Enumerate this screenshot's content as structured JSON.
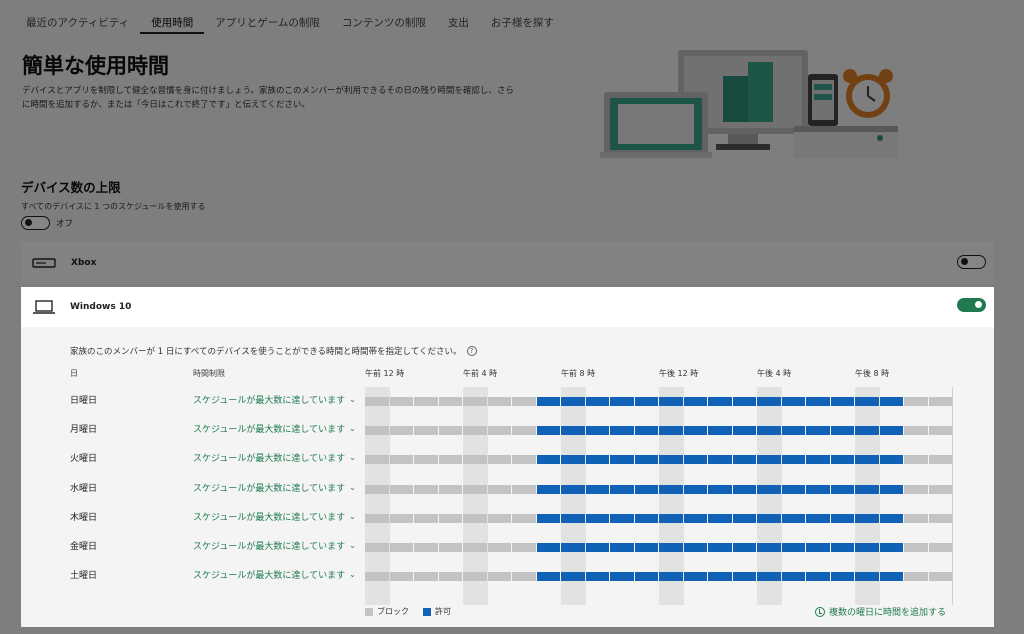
{
  "tabs": [
    {
      "label": "最近のアクティビティ",
      "active": false
    },
    {
      "label": "使用時間",
      "active": true
    },
    {
      "label": "アプリとゲームの制限",
      "active": false
    },
    {
      "label": "コンテンツの制限",
      "active": false
    },
    {
      "label": "支出",
      "active": false
    },
    {
      "label": "お子様を探す",
      "active": false
    }
  ],
  "page": {
    "title": "簡単な使用時間",
    "description": "デバイスとアプリを制限して健全な習慣を身に付けましょう。家族のこのメンバーが利用できるその日の残り時間を確認し、さらに時間を追加するか、または「今日はこれで終了です」と伝えてください。"
  },
  "device_limit": {
    "title": "デバイス数の上限",
    "subtitle": "すべてのデバイスに 1 つのスケジュールを使用する",
    "toggle_state": "オフ",
    "toggle_on": false
  },
  "devices": {
    "xbox": {
      "name": "Xbox",
      "icon": "xbox-console-icon",
      "toggle_on": false
    },
    "windows": {
      "name": "Windows 10",
      "icon": "laptop-icon",
      "toggle_on": true
    }
  },
  "schedule": {
    "description": "家族のこのメンバーが 1 日にすべてのデバイスを使うことができる時間と時間帯を指定してください。",
    "col_day": "日",
    "col_limit": "時間制限",
    "hour_labels": [
      "午前 12 時",
      "午前 4 時",
      "午前 8 時",
      "午後 12 時",
      "午後 4 時",
      "午後 8 時"
    ],
    "allowed_start_hour": 7,
    "allowed_end_hour": 22,
    "days": [
      {
        "day": "日曜日",
        "limit": "スケジュールが最大数に達しています"
      },
      {
        "day": "月曜日",
        "limit": "スケジュールが最大数に達しています"
      },
      {
        "day": "火曜日",
        "limit": "スケジュールが最大数に達しています"
      },
      {
        "day": "水曜日",
        "limit": "スケジュールが最大数に達しています"
      },
      {
        "day": "木曜日",
        "limit": "スケジュールが最大数に達しています"
      },
      {
        "day": "金曜日",
        "limit": "スケジュールが最大数に達しています"
      },
      {
        "day": "土曜日",
        "limit": "スケジュールが最大数に達しています"
      }
    ],
    "legend_block": "ブロック",
    "legend_allow": "許可",
    "add_link": "複数の曜日に時間を追加する"
  },
  "colors": {
    "accent": "#1f7a4f",
    "allow": "#0f62b5",
    "block": "#c3c3c3"
  }
}
